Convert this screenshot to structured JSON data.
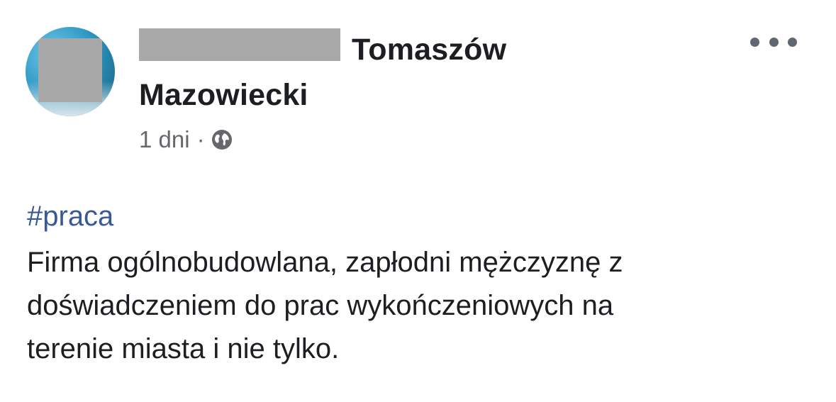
{
  "post": {
    "author": {
      "name_line1": "Tomaszów",
      "name_line2": "Mazowiecki"
    },
    "meta": {
      "time": "1 dni",
      "separator": "·",
      "privacy_icon": "globe-icon"
    },
    "more_icon": "more-options-icon",
    "hashtag": "#praca",
    "text_lines": [
      "Firma ogólnobudowlana, zapłodni mężczyznę z",
      "doświadczeniem do prac wykończeniowych na",
      "terenie miasta i nie tylko."
    ]
  },
  "colors": {
    "name_text": "#1c1e21",
    "meta_text": "#65676b",
    "hashtag": "#385898",
    "censor": "#a9a9a9"
  }
}
